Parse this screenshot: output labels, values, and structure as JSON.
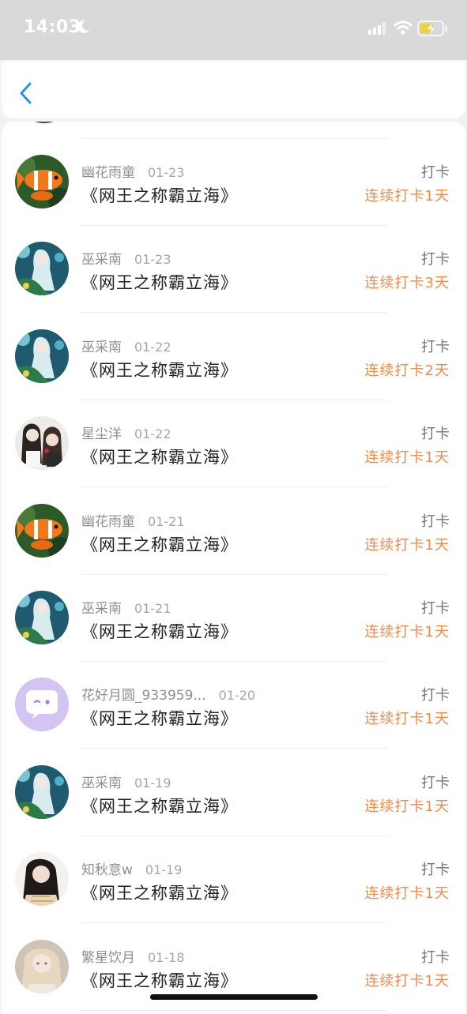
{
  "status": {
    "time": "14:03"
  },
  "list": {
    "items": [
      {
        "user": "幽花雨童",
        "date": "01-23",
        "title": "《网王之称霸立海》",
        "type": "打卡",
        "streak": "连续打卡1天",
        "avatar": "clownfish-avatar"
      },
      {
        "user": "巫采南",
        "date": "01-23",
        "title": "《网王之称霸立海》",
        "type": "打卡",
        "streak": "连续打卡3天",
        "avatar": "anime-girl-avatar"
      },
      {
        "user": "巫采南",
        "date": "01-22",
        "title": "《网王之称霸立海》",
        "type": "打卡",
        "streak": "连续打卡2天",
        "avatar": "anime-girl-avatar"
      },
      {
        "user": "星尘洋",
        "date": "01-22",
        "title": "《网王之称霸立海》",
        "type": "打卡",
        "streak": "连续打卡1天",
        "avatar": "anime-pair-avatar"
      },
      {
        "user": "幽花雨童",
        "date": "01-21",
        "title": "《网王之称霸立海》",
        "type": "打卡",
        "streak": "连续打卡1天",
        "avatar": "clownfish-avatar"
      },
      {
        "user": "巫采南",
        "date": "01-21",
        "title": "《网王之称霸立海》",
        "type": "打卡",
        "streak": "连续打卡1天",
        "avatar": "anime-girl-avatar"
      },
      {
        "user": "花好月圆_933959...",
        "date": "01-20",
        "title": "《网王之称霸立海》",
        "type": "打卡",
        "streak": "连续打卡1天",
        "avatar": "default-chat-avatar"
      },
      {
        "user": "巫采南",
        "date": "01-19",
        "title": "《网王之称霸立海》",
        "type": "打卡",
        "streak": "连续打卡1天",
        "avatar": "anime-girl-avatar"
      },
      {
        "user": "知秋意w",
        "date": "01-19",
        "title": "《网王之称霸立海》",
        "type": "打卡",
        "streak": "连续打卡1天",
        "avatar": "girl-photo-avatar"
      },
      {
        "user": "繁星饮月",
        "date": "01-18",
        "title": "《网王之称霸立海》",
        "type": "打卡",
        "streak": "连续打卡1天",
        "avatar": "blonde-girl-avatar"
      }
    ]
  }
}
